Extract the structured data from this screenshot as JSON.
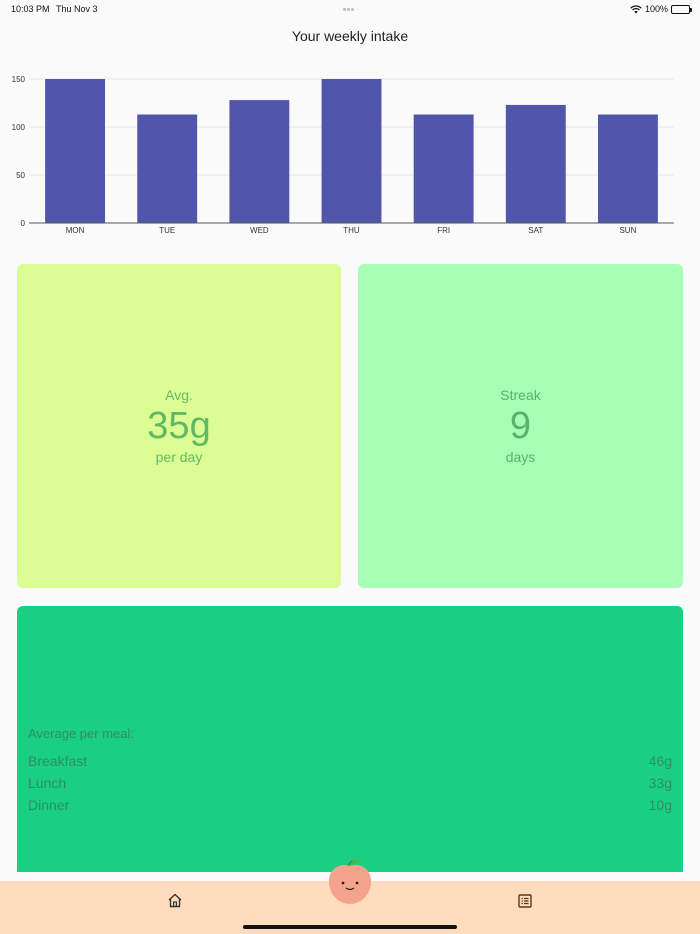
{
  "status": {
    "time": "10:03 PM",
    "date": "Thu Nov 3",
    "battery": "100%"
  },
  "chart_title": "Your weekly intake",
  "chart_data": {
    "type": "bar",
    "categories": [
      "MON",
      "TUE",
      "WED",
      "THU",
      "FRI",
      "SAT",
      "SUN"
    ],
    "values": [
      150,
      113,
      128,
      150,
      113,
      123,
      113
    ],
    "title": "Your weekly intake",
    "ylim": [
      0,
      150
    ],
    "yticks": [
      0,
      50,
      100,
      150
    ],
    "grid": true,
    "color": "#5256ab"
  },
  "avg_card": {
    "label": "Avg.",
    "value": "35g",
    "unit": "per day",
    "color": "#dbfd94"
  },
  "streak_card": {
    "label": "Streak",
    "value": "9",
    "unit": "days",
    "color": "#a6ffb4"
  },
  "meals": {
    "title": "Average per meal:",
    "items": [
      {
        "name": "Breakfast",
        "value": "46g"
      },
      {
        "name": "Lunch",
        "value": "33g"
      },
      {
        "name": "Dinner",
        "value": "10g"
      }
    ],
    "color": "#1bcf82"
  },
  "tabbar": {
    "icons": [
      "home-icon",
      "peach-icon",
      "list-icon"
    ],
    "color": "#ffdcbe"
  }
}
